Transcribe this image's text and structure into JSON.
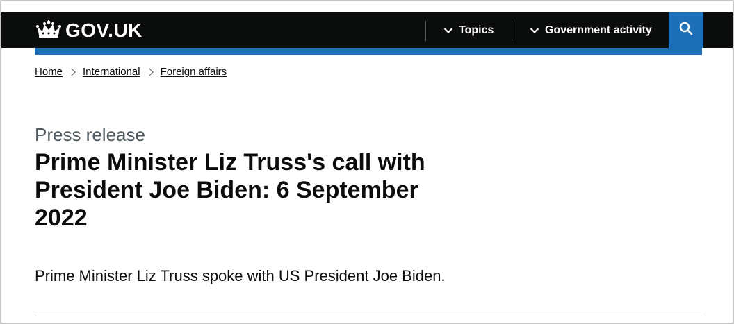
{
  "header": {
    "logo_text": "GOV.UK",
    "logo_icon": "crown-icon",
    "nav": [
      {
        "label": "Topics",
        "icon": "chevron-down-icon"
      },
      {
        "label": "Government activity",
        "icon": "chevron-down-icon"
      }
    ],
    "search_icon": "search-icon",
    "colors": {
      "bar": "#0b0c0c",
      "accent": "#1d70b8",
      "text": "#ffffff"
    }
  },
  "breadcrumb": [
    {
      "label": "Home"
    },
    {
      "label": "International"
    },
    {
      "label": "Foreign affairs"
    }
  ],
  "main": {
    "caption": "Press release",
    "title": "Prime Minister Liz Truss's call with President Joe Biden: 6 September 2022",
    "lead": "Prime Minister Liz Truss spoke with US President Joe Biden."
  }
}
